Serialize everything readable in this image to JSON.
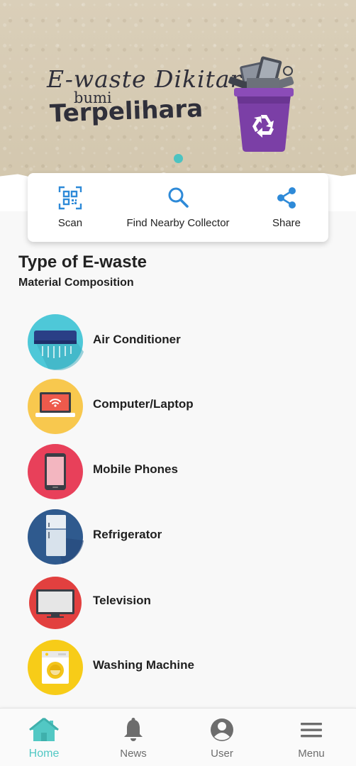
{
  "banner": {
    "slogan_line1": "E-waste Dikitar,",
    "slogan_line2": "bumi",
    "slogan_line3": "Terpelihara"
  },
  "quick_actions": [
    {
      "label": "Scan",
      "icon": "qr-scan-icon"
    },
    {
      "label": "Find Nearby Collector",
      "icon": "search-icon"
    },
    {
      "label": "Share",
      "icon": "share-icon"
    }
  ],
  "section": {
    "title": "Type of E-waste",
    "subtitle": "Material Composition"
  },
  "ewaste_types": [
    {
      "label": "Air Conditioner",
      "icon": "air-conditioner-icon",
      "color": "#4ec8d8"
    },
    {
      "label": "Computer/Laptop",
      "icon": "laptop-icon",
      "color": "#f8c84e"
    },
    {
      "label": "Mobile Phones",
      "icon": "mobile-phone-icon",
      "color": "#e8405a"
    },
    {
      "label": "Refrigerator",
      "icon": "refrigerator-icon",
      "color": "#2f5a8e"
    },
    {
      "label": "Television",
      "icon": "television-icon",
      "color": "#e2403f"
    },
    {
      "label": "Washing Machine",
      "icon": "washing-machine-icon",
      "color": "#f7cc18"
    }
  ],
  "bottom_nav": [
    {
      "label": "Home",
      "icon": "home-icon",
      "active": true
    },
    {
      "label": "News",
      "icon": "bell-icon",
      "active": false
    },
    {
      "label": "User",
      "icon": "user-icon",
      "active": false
    },
    {
      "label": "Menu",
      "icon": "menu-icon",
      "active": false
    }
  ],
  "colors": {
    "accent": "#52c8c4",
    "action_icon": "#2e8ad8",
    "nav_inactive": "#6d6d6d"
  }
}
